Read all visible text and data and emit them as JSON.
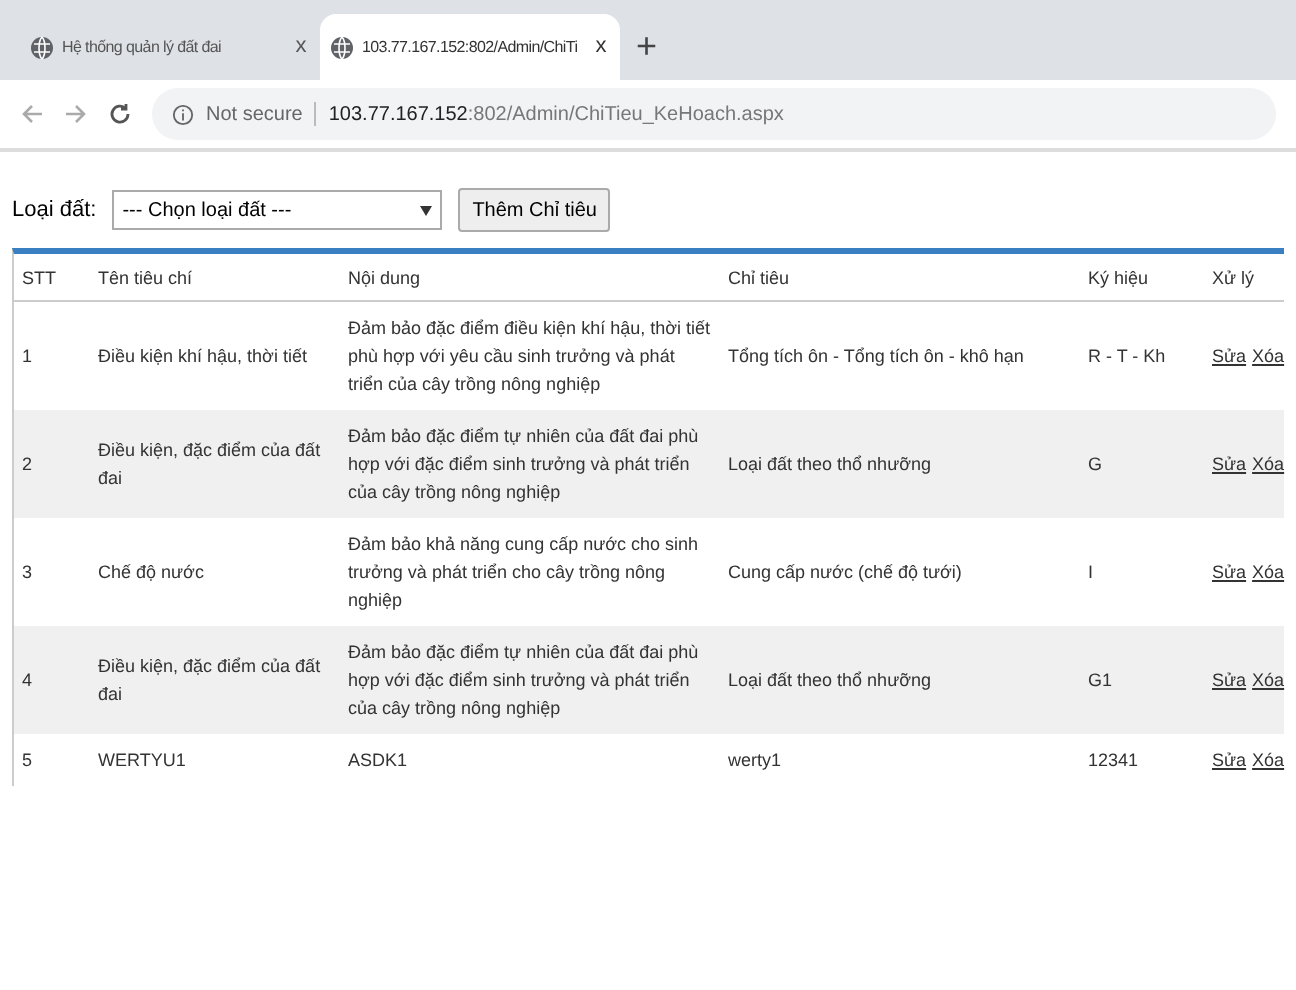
{
  "browser": {
    "tabs": [
      {
        "title": "Hệ thống quản lý đất đai",
        "close": "x",
        "selected": false
      },
      {
        "title": "103.77.167.152:802/Admin/ChiTi",
        "close": "x",
        "selected": true
      }
    ],
    "new_tab": "+",
    "security": "Not secure",
    "url_host": "103.77.167.152",
    "url_path": ":802/Admin/ChiTieu_KeHoach.aspx"
  },
  "filter": {
    "label": "Loại đất:",
    "select_value": "--- Chọn loại đất ---",
    "add_button": "Thêm Chỉ tiêu"
  },
  "table": {
    "columns": [
      "STT",
      "Tên tiêu chí",
      "Nội dung",
      "Chỉ tiêu",
      "Ký hiệu",
      "Xử lý"
    ],
    "rows": [
      {
        "stt": "1",
        "name": "Điều kiện khí hậu, thời tiết",
        "content": "Đảm bảo đặc điểm điều kiện khí hậu, thời tiết phù hợp với yêu cầu sinh trưởng và phát triển của cây trồng nông nghiệp",
        "criteria": "Tổng tích ôn - Tổng tích ôn - khô hạn",
        "symbol": "R - T - Kh",
        "edit": "Sửa",
        "delete": "Xóa"
      },
      {
        "stt": "2",
        "name": "Điều kiện, đặc điểm của đất đai",
        "content": "Đảm bảo đặc điểm tự nhiên của đất đai phù hợp với đặc điểm sinh trưởng và phát triển của cây trồng nông nghiệp",
        "criteria": "Loại đất theo thổ nhưỡng",
        "symbol": "G",
        "edit": "Sửa",
        "delete": "Xóa"
      },
      {
        "stt": "3",
        "name": "Chế độ nước",
        "content": "Đảm bảo khả năng cung cấp nước cho sinh trưởng và phát triển cho cây trồng nông nghiệp",
        "criteria": "Cung cấp nước (chế độ tưới)",
        "symbol": "I",
        "edit": "Sửa",
        "delete": "Xóa"
      },
      {
        "stt": "4",
        "name": "Điều kiện, đặc điểm của đất đai",
        "content": "Đảm bảo đặc điểm tự nhiên của đất đai phù hợp với đặc điểm sinh trưởng và phát triển của cây trồng nông nghiệp",
        "criteria": "Loại đất theo thổ nhưỡng",
        "symbol": "G1",
        "edit": "Sửa",
        "delete": "Xóa"
      },
      {
        "stt": "5",
        "name": "WERTYU1",
        "content": "ASDK1",
        "criteria": "werty1",
        "symbol": "12341",
        "edit": "Sửa",
        "delete": "Xóa"
      }
    ]
  }
}
